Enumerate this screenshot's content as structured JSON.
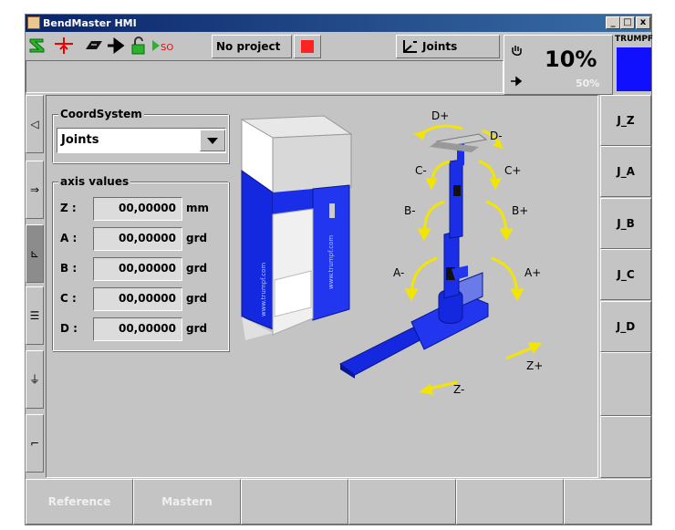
{
  "window": {
    "title": "BendMaster HMI",
    "min": "_",
    "max": "□",
    "close": "x"
  },
  "toolbar": {
    "project_label": "No project",
    "mode_label": "Joints",
    "mode_icon": "coordinate-axes-icon"
  },
  "speed": {
    "value": "10%",
    "sub_value": "50%"
  },
  "brand": {
    "logo_text": "TRUMPF",
    "color": "#1010ff"
  },
  "coord_system": {
    "title": "CoordSystem",
    "selected": "Joints"
  },
  "axis_values": {
    "title": "axis values",
    "rows": [
      {
        "label": "Z :",
        "value": "00,00000",
        "unit": "mm"
      },
      {
        "label": "A :",
        "value": "00,00000",
        "unit": "grd"
      },
      {
        "label": "B :",
        "value": "00,00000",
        "unit": "grd"
      },
      {
        "label": "C :",
        "value": "00,00000",
        "unit": "grd"
      },
      {
        "label": "D :",
        "value": "00,00000",
        "unit": "grd"
      }
    ]
  },
  "diagram": {
    "labels": {
      "d_plus": "D+",
      "d_minus": "D-",
      "c_minus": "C-",
      "c_plus": "C+",
      "b_minus": "B-",
      "b_plus": "B+",
      "a_minus": "A-",
      "a_plus": "A+",
      "z_plus": "Z+",
      "z_minus": "Z-"
    },
    "machine_text": "www.trumpf.com"
  },
  "right_buttons": [
    "J_Z",
    "J_A",
    "J_B",
    "J_C",
    "J_D"
  ],
  "bottom_buttons": [
    "Reference",
    "Mastern",
    "",
    "",
    "",
    ""
  ],
  "colors": {
    "accent_blue": "#1428e0",
    "arrow_yellow": "#f2e600",
    "panel": "#c4c4c4"
  }
}
